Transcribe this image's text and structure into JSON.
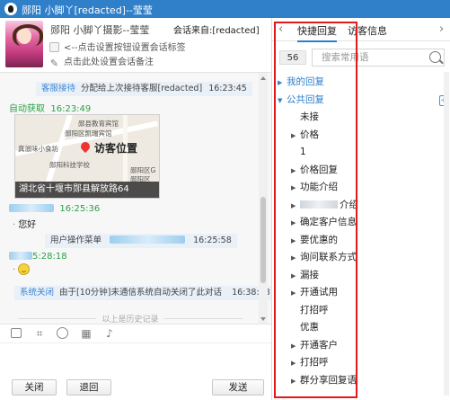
{
  "window": {
    "title": "郧阳  小脚丫[redacted]--莹莹"
  },
  "header": {
    "name": "郧阳    小脚丫摄影--莹莹",
    "from": "会话来自:[redacted]",
    "tag_hint": "<--点击设置按钮设置会话标签",
    "note_hint": "点击此处设置会话备注"
  },
  "chat": {
    "messages": [
      {
        "tag": "客服接待",
        "text": "分配给上次接待客服[redacted]",
        "time": "16:23:45"
      },
      {
        "sender": "自动获取",
        "time": "16:23:49"
      },
      {
        "map_caption": "湖北省十堰市郧县解放路64",
        "map_label": "访客位置",
        "map_pois": [
          "郧县教育宾馆",
          "郧阳区凯瑞宾馆",
          "真滋味小食坊",
          "郧阳科技学校",
          "郧阳区G",
          "郧阳区"
        ]
      },
      {
        "sender": "[redacted]",
        "time": "16:25:36",
        "text": "您好"
      },
      {
        "tag": "用户操作菜单",
        "text": "[redacted]",
        "time": "16:25:58"
      },
      {
        "sender": "[redacted]",
        "time": "5:28:18",
        "emoji": "smile"
      },
      {
        "tag": "系统关闭",
        "text": "由于[10分钟]未通信系统自动关闭了此对话",
        "time": "16:38:18"
      }
    ],
    "history_label": "以上是历史记录"
  },
  "toolbar": {
    "icons": [
      "image-icon",
      "crop-icon",
      "emoji-icon",
      "screenshot-icon",
      "voice-icon"
    ]
  },
  "buttons": {
    "close": "关闭",
    "back": "退回",
    "send": "发送"
  },
  "quick_reply": {
    "tabs": [
      "快捷回复",
      "访客信息"
    ],
    "count": "56",
    "search_placeholder": "搜索常用语",
    "items": [
      {
        "label": "我的回复",
        "kind": "group",
        "expanded": false
      },
      {
        "label": "公共回复",
        "kind": "group",
        "expanded": true
      },
      {
        "label": "未接",
        "kind": "leaf"
      },
      {
        "label": "价格",
        "kind": "folder"
      },
      {
        "label": "1",
        "kind": "leaf"
      },
      {
        "label": "价格回复",
        "kind": "folder"
      },
      {
        "label": "功能介绍",
        "kind": "folder"
      },
      {
        "label": "介绍",
        "kind": "folder",
        "redacted_prefix": true
      },
      {
        "label": "确定客户信息",
        "kind": "folder"
      },
      {
        "label": "要优惠的",
        "kind": "folder"
      },
      {
        "label": "询问联系方式",
        "kind": "folder"
      },
      {
        "label": "漏接",
        "kind": "folder"
      },
      {
        "label": "开通试用",
        "kind": "folder"
      },
      {
        "label": "打招呼",
        "kind": "leaf"
      },
      {
        "label": "优惠",
        "kind": "leaf"
      },
      {
        "label": "开通客户",
        "kind": "folder"
      },
      {
        "label": "打招呼",
        "kind": "folder"
      },
      {
        "label": "群分享回复语",
        "kind": "folder"
      }
    ]
  },
  "colors": {
    "titlebar": "#2f7fc9",
    "accent": "#3d86d4",
    "green": "#2aa145",
    "highlight": "#e3191c"
  }
}
